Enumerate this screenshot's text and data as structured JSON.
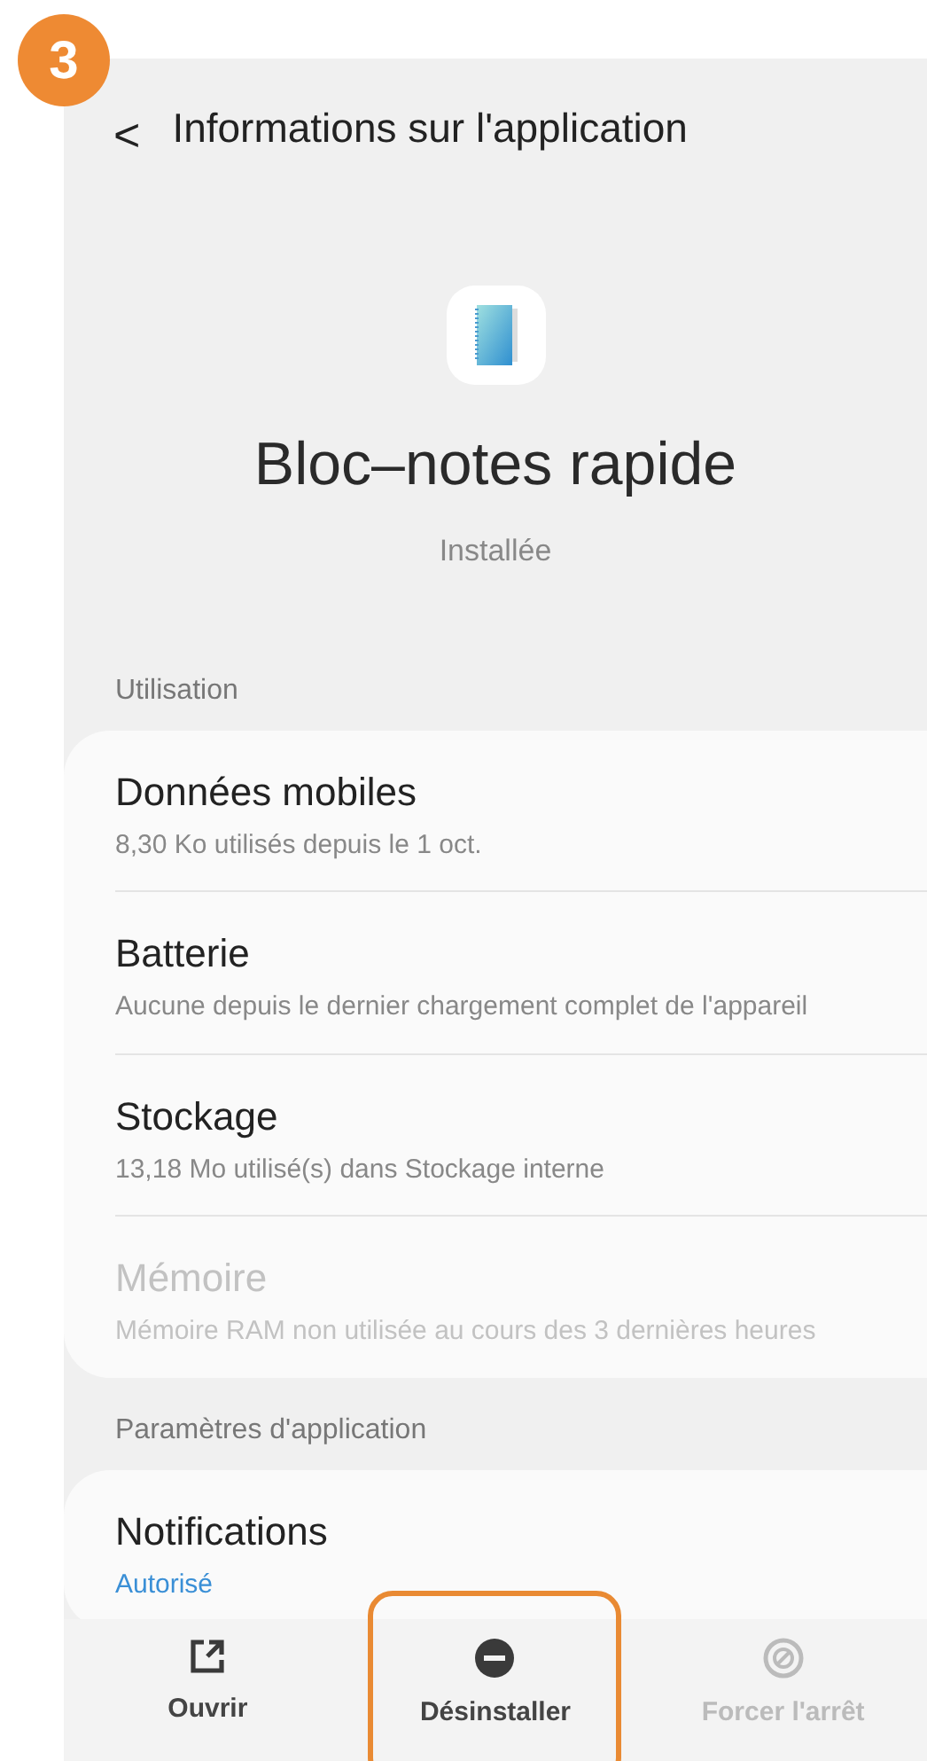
{
  "step_badge": "3",
  "header": {
    "back": "<",
    "title": "Informations sur l'application"
  },
  "app": {
    "name": "Bloc–notes rapide",
    "status": "Installée"
  },
  "sections": [
    {
      "title": "Utilisation",
      "items": [
        {
          "title": "Données mobiles",
          "subtitle": "8,30 Ko utilisés depuis le 1 oct.",
          "disabled": false
        },
        {
          "title": "Batterie",
          "subtitle": "Aucune depuis le dernier chargement complet de l'appareil",
          "disabled": false
        },
        {
          "title": "Stockage",
          "subtitle": "13,18 Mo utilisé(s) dans Stockage interne",
          "disabled": false
        },
        {
          "title": "Mémoire",
          "subtitle": "Mémoire RAM non utilisée au cours des 3 dernières heures",
          "disabled": true
        }
      ]
    },
    {
      "title": "Paramètres d'application",
      "items": [
        {
          "title": "Notifications",
          "subtitle": "Autorisé",
          "accent": true,
          "disabled": false
        }
      ]
    }
  ],
  "bottom_bar": [
    {
      "label": "Ouvrir",
      "kind": "open",
      "disabled": false,
      "highlighted": false
    },
    {
      "label": "Désinstaller",
      "kind": "uninstall",
      "disabled": false,
      "highlighted": true
    },
    {
      "label": "Forcer l'arrêt",
      "kind": "stop",
      "disabled": true,
      "highlighted": false
    }
  ]
}
